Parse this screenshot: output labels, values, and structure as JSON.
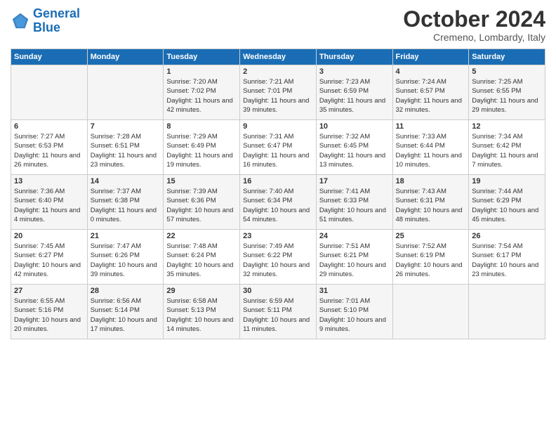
{
  "header": {
    "logo_line1": "General",
    "logo_line2": "Blue",
    "month": "October 2024",
    "location": "Cremeno, Lombardy, Italy"
  },
  "days_of_week": [
    "Sunday",
    "Monday",
    "Tuesday",
    "Wednesday",
    "Thursday",
    "Friday",
    "Saturday"
  ],
  "weeks": [
    [
      {
        "day": "",
        "info": ""
      },
      {
        "day": "",
        "info": ""
      },
      {
        "day": "1",
        "info": "Sunrise: 7:20 AM\nSunset: 7:02 PM\nDaylight: 11 hours and 42 minutes."
      },
      {
        "day": "2",
        "info": "Sunrise: 7:21 AM\nSunset: 7:01 PM\nDaylight: 11 hours and 39 minutes."
      },
      {
        "day": "3",
        "info": "Sunrise: 7:23 AM\nSunset: 6:59 PM\nDaylight: 11 hours and 35 minutes."
      },
      {
        "day": "4",
        "info": "Sunrise: 7:24 AM\nSunset: 6:57 PM\nDaylight: 11 hours and 32 minutes."
      },
      {
        "day": "5",
        "info": "Sunrise: 7:25 AM\nSunset: 6:55 PM\nDaylight: 11 hours and 29 minutes."
      }
    ],
    [
      {
        "day": "6",
        "info": "Sunrise: 7:27 AM\nSunset: 6:53 PM\nDaylight: 11 hours and 26 minutes."
      },
      {
        "day": "7",
        "info": "Sunrise: 7:28 AM\nSunset: 6:51 PM\nDaylight: 11 hours and 23 minutes."
      },
      {
        "day": "8",
        "info": "Sunrise: 7:29 AM\nSunset: 6:49 PM\nDaylight: 11 hours and 19 minutes."
      },
      {
        "day": "9",
        "info": "Sunrise: 7:31 AM\nSunset: 6:47 PM\nDaylight: 11 hours and 16 minutes."
      },
      {
        "day": "10",
        "info": "Sunrise: 7:32 AM\nSunset: 6:45 PM\nDaylight: 11 hours and 13 minutes."
      },
      {
        "day": "11",
        "info": "Sunrise: 7:33 AM\nSunset: 6:44 PM\nDaylight: 11 hours and 10 minutes."
      },
      {
        "day": "12",
        "info": "Sunrise: 7:34 AM\nSunset: 6:42 PM\nDaylight: 11 hours and 7 minutes."
      }
    ],
    [
      {
        "day": "13",
        "info": "Sunrise: 7:36 AM\nSunset: 6:40 PM\nDaylight: 11 hours and 4 minutes."
      },
      {
        "day": "14",
        "info": "Sunrise: 7:37 AM\nSunset: 6:38 PM\nDaylight: 11 hours and 0 minutes."
      },
      {
        "day": "15",
        "info": "Sunrise: 7:39 AM\nSunset: 6:36 PM\nDaylight: 10 hours and 57 minutes."
      },
      {
        "day": "16",
        "info": "Sunrise: 7:40 AM\nSunset: 6:34 PM\nDaylight: 10 hours and 54 minutes."
      },
      {
        "day": "17",
        "info": "Sunrise: 7:41 AM\nSunset: 6:33 PM\nDaylight: 10 hours and 51 minutes."
      },
      {
        "day": "18",
        "info": "Sunrise: 7:43 AM\nSunset: 6:31 PM\nDaylight: 10 hours and 48 minutes."
      },
      {
        "day": "19",
        "info": "Sunrise: 7:44 AM\nSunset: 6:29 PM\nDaylight: 10 hours and 45 minutes."
      }
    ],
    [
      {
        "day": "20",
        "info": "Sunrise: 7:45 AM\nSunset: 6:27 PM\nDaylight: 10 hours and 42 minutes."
      },
      {
        "day": "21",
        "info": "Sunrise: 7:47 AM\nSunset: 6:26 PM\nDaylight: 10 hours and 39 minutes."
      },
      {
        "day": "22",
        "info": "Sunrise: 7:48 AM\nSunset: 6:24 PM\nDaylight: 10 hours and 35 minutes."
      },
      {
        "day": "23",
        "info": "Sunrise: 7:49 AM\nSunset: 6:22 PM\nDaylight: 10 hours and 32 minutes."
      },
      {
        "day": "24",
        "info": "Sunrise: 7:51 AM\nSunset: 6:21 PM\nDaylight: 10 hours and 29 minutes."
      },
      {
        "day": "25",
        "info": "Sunrise: 7:52 AM\nSunset: 6:19 PM\nDaylight: 10 hours and 26 minutes."
      },
      {
        "day": "26",
        "info": "Sunrise: 7:54 AM\nSunset: 6:17 PM\nDaylight: 10 hours and 23 minutes."
      }
    ],
    [
      {
        "day": "27",
        "info": "Sunrise: 6:55 AM\nSunset: 5:16 PM\nDaylight: 10 hours and 20 minutes."
      },
      {
        "day": "28",
        "info": "Sunrise: 6:56 AM\nSunset: 5:14 PM\nDaylight: 10 hours and 17 minutes."
      },
      {
        "day": "29",
        "info": "Sunrise: 6:58 AM\nSunset: 5:13 PM\nDaylight: 10 hours and 14 minutes."
      },
      {
        "day": "30",
        "info": "Sunrise: 6:59 AM\nSunset: 5:11 PM\nDaylight: 10 hours and 11 minutes."
      },
      {
        "day": "31",
        "info": "Sunrise: 7:01 AM\nSunset: 5:10 PM\nDaylight: 10 hours and 9 minutes."
      },
      {
        "day": "",
        "info": ""
      },
      {
        "day": "",
        "info": ""
      }
    ]
  ]
}
